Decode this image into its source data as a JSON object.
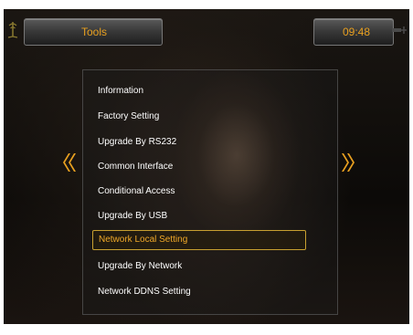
{
  "header": {
    "title": "Tools",
    "clock": "09:48"
  },
  "menu": {
    "items": [
      {
        "label": "Information"
      },
      {
        "label": "Factory Setting"
      },
      {
        "label": "Upgrade By RS232"
      },
      {
        "label": "Common Interface"
      },
      {
        "label": "Conditional Access"
      },
      {
        "label": "Upgrade By USB"
      },
      {
        "label": "Network Local Setting",
        "selected": true
      },
      {
        "label": "Upgrade By Network"
      },
      {
        "label": "Network DDNS Setting"
      }
    ]
  },
  "nav": {
    "left_arrow_icon": "double-chevron-left-icon",
    "right_arrow_icon": "double-chevron-right-icon"
  },
  "colors": {
    "accent": "#e8a020",
    "menu_text": "#ffffff",
    "selection_border": "#c8a030"
  }
}
